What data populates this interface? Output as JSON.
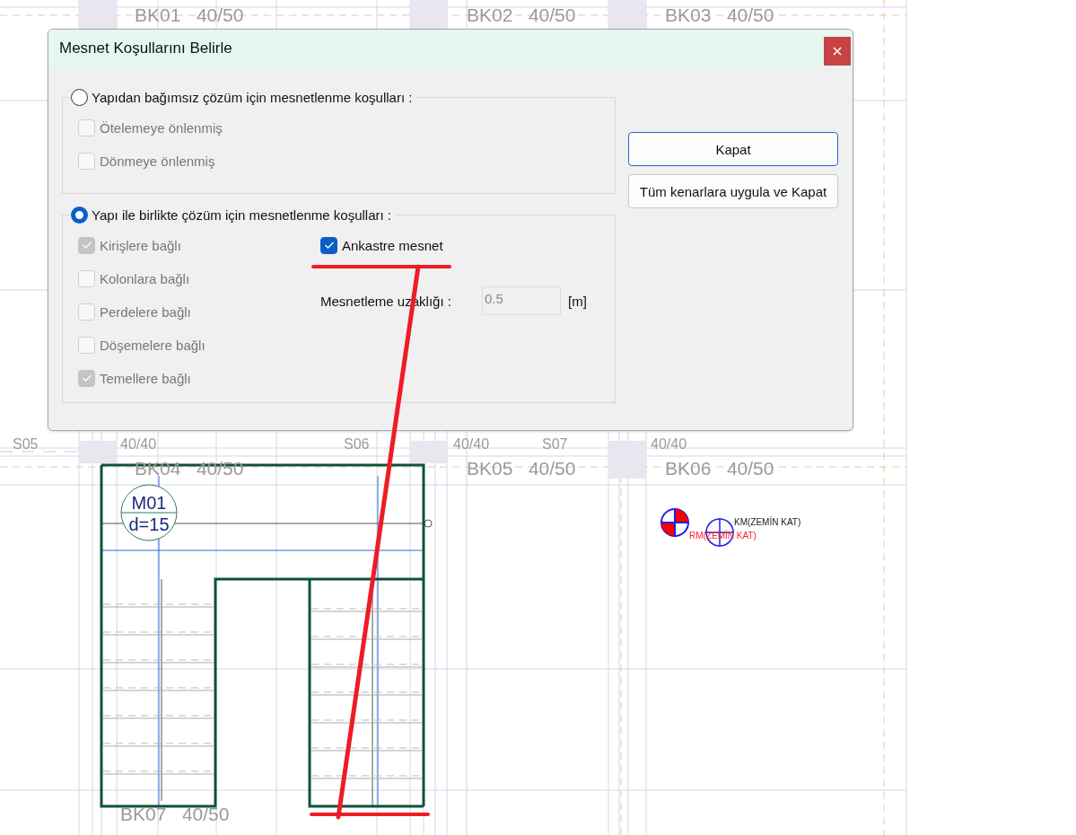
{
  "canvas": {
    "beams": [
      {
        "name": "BK01",
        "size": "40/50"
      },
      {
        "name": "BK02",
        "size": "40/50"
      },
      {
        "name": "BK03",
        "size": "40/50"
      },
      {
        "name": "BK04",
        "size": "40/50"
      },
      {
        "name": "BK05",
        "size": "40/50"
      },
      {
        "name": "BK06",
        "size": "40/50"
      },
      {
        "name": "BK07",
        "size": "40/50"
      }
    ],
    "columns": [
      {
        "name": "S05",
        "size": "40/40"
      },
      {
        "name": "S06",
        "size": "40/40"
      },
      {
        "name": "S07",
        "size": "40/40"
      }
    ],
    "slab": {
      "name": "M01",
      "thickness": "d=15"
    },
    "markers": [
      {
        "label": "KM(ZEMİN KAT)",
        "color": "#1a1a1a"
      },
      {
        "label": "RM(ZEMİN KAT)",
        "color": "#ff2020"
      }
    ]
  },
  "dialog": {
    "title": "Mesnet Koşullarını Belirle",
    "groups": [
      {
        "label": "Yapıdan bağımsız çözüm için mesnetlenme koşulları  :",
        "selected": false,
        "options": [
          {
            "label": "Ötelemeye önlenmiş",
            "checked": false,
            "disabled": true
          },
          {
            "label": "Dönmeye önlenmiş",
            "checked": false,
            "disabled": true
          }
        ]
      },
      {
        "label": "Yapı ile birlikte çözüm için mesnetlenme koşulları  :",
        "selected": true,
        "options": [
          {
            "label": "Kirişlere bağlı",
            "checked": true,
            "disabled": true
          },
          {
            "label": "Kolonlara bağlı",
            "checked": false,
            "disabled": true
          },
          {
            "label": "Perdelere bağlı",
            "checked": false,
            "disabled": true
          },
          {
            "label": "Döşemelere bağlı",
            "checked": false,
            "disabled": true
          },
          {
            "label": "Temellere bağlı",
            "checked": true,
            "disabled": true
          }
        ],
        "fixed_support": {
          "label": "Ankastre mesnet",
          "checked": true
        },
        "distance_field": {
          "label": "Mesnetleme uzaklığı :",
          "value": "0.5",
          "unit": "[m]",
          "disabled": true
        }
      }
    ],
    "buttons": [
      {
        "label": "Kapat",
        "default": true
      },
      {
        "label": "Tüm kenarlara uygula ve Kapat",
        "default": false
      }
    ]
  }
}
